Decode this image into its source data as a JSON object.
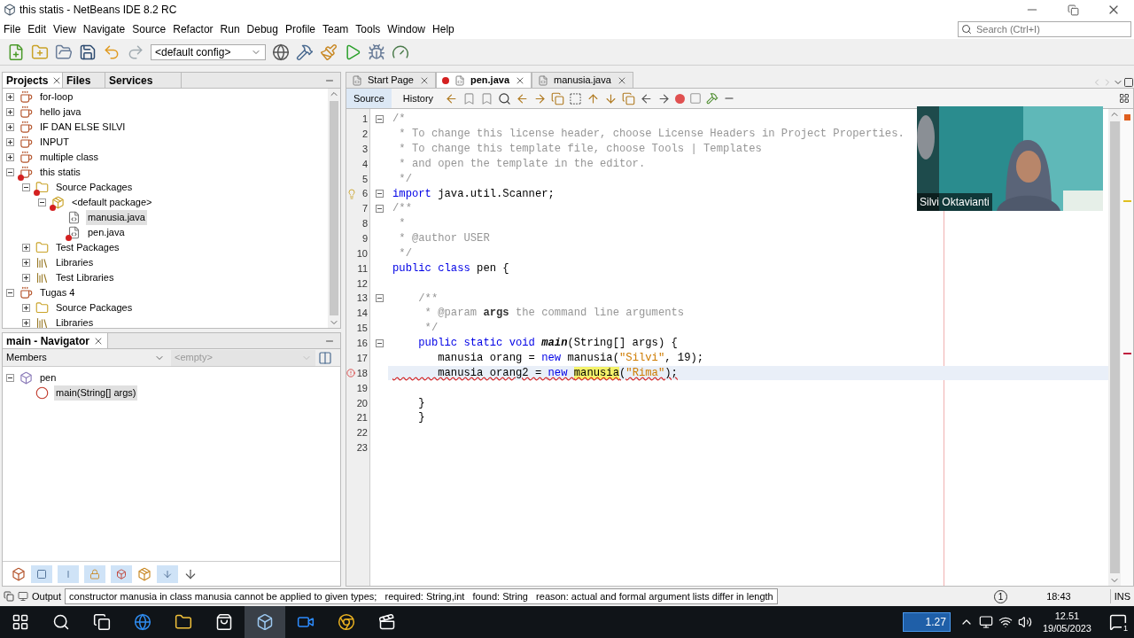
{
  "window": {
    "title": "this statis - NetBeans IDE 8.2 RC",
    "search_placeholder": "Search (Ctrl+I)"
  },
  "menu": [
    "File",
    "Edit",
    "View",
    "Navigate",
    "Source",
    "Refactor",
    "Run",
    "Debug",
    "Profile",
    "Team",
    "Tools",
    "Window",
    "Help"
  ],
  "toolbar": {
    "config": "<default config>"
  },
  "projects_panel": {
    "tabs": [
      {
        "label": "Projects",
        "selected": true,
        "closable": true
      },
      {
        "label": "Files",
        "selected": false,
        "closable": false
      },
      {
        "label": "Services",
        "selected": false,
        "closable": false
      }
    ],
    "tree": [
      {
        "label": "for-loop",
        "kind": "project",
        "expanded": false,
        "selected": false,
        "error": false
      },
      {
        "label": "hello java",
        "kind": "project",
        "expanded": false,
        "selected": false,
        "error": false
      },
      {
        "label": "IF DAN ELSE SILVI",
        "kind": "project",
        "expanded": false,
        "selected": false,
        "error": false
      },
      {
        "label": "INPUT",
        "kind": "project",
        "expanded": false,
        "selected": false,
        "error": false
      },
      {
        "label": "multiple class",
        "kind": "project",
        "expanded": false,
        "selected": false,
        "error": false
      },
      {
        "label": "this statis",
        "kind": "project",
        "expanded": true,
        "selected": false,
        "error": true,
        "children": [
          {
            "label": "Source Packages",
            "kind": "folder",
            "expanded": true,
            "selected": false,
            "error": true,
            "children": [
              {
                "label": "<default package>",
                "kind": "package",
                "expanded": true,
                "selected": false,
                "error": true,
                "children": [
                  {
                    "label": "manusia.java",
                    "kind": "file",
                    "selected": true,
                    "error": false
                  },
                  {
                    "label": "pen.java",
                    "kind": "file",
                    "selected": false,
                    "error": true
                  }
                ]
              }
            ]
          },
          {
            "label": "Test Packages",
            "kind": "folder",
            "expanded": false,
            "selected": false,
            "error": false
          },
          {
            "label": "Libraries",
            "kind": "library",
            "expanded": false,
            "selected": false,
            "error": false
          },
          {
            "label": "Test Libraries",
            "kind": "library",
            "expanded": false,
            "selected": false,
            "error": false
          }
        ]
      },
      {
        "label": "Tugas 4",
        "kind": "project",
        "expanded": true,
        "selected": false,
        "error": false,
        "children": [
          {
            "label": "Source Packages",
            "kind": "folder",
            "expanded": false,
            "selected": false,
            "error": false
          },
          {
            "label": "Libraries",
            "kind": "library",
            "expanded": false,
            "selected": false,
            "error": false
          }
        ]
      }
    ]
  },
  "navigator": {
    "title": "main - Navigator",
    "filter": "Members",
    "member": "<empty>",
    "tree": [
      {
        "label": "pen",
        "kind": "class",
        "expanded": true,
        "selected": false,
        "children": [
          {
            "label": "main(String[] args)",
            "kind": "method",
            "selected": true
          }
        ]
      }
    ]
  },
  "editor": {
    "tabs": [
      {
        "label": "Start Page",
        "selected": false,
        "error": false
      },
      {
        "label": "pen.java",
        "selected": true,
        "error": true
      },
      {
        "label": "manusia.java",
        "selected": false,
        "error": false
      }
    ],
    "views": [
      {
        "label": "Source",
        "selected": true
      },
      {
        "label": "History",
        "selected": false
      }
    ],
    "lines": [
      {
        "number": "1",
        "fold": true,
        "current": false,
        "warning": false,
        "error": false,
        "segments": [
          {
            "text": "/*",
            "kind": "comment"
          }
        ]
      },
      {
        "number": "2",
        "fold": false,
        "current": false,
        "warning": false,
        "error": false,
        "segments": [
          {
            "text": " * To change this license header, choose License Headers in Project Properties.",
            "kind": "comment"
          }
        ]
      },
      {
        "number": "3",
        "fold": false,
        "current": false,
        "warning": false,
        "error": false,
        "segments": [
          {
            "text": " * To change this template file, choose Tools | Templates",
            "kind": "comment"
          }
        ]
      },
      {
        "number": "4",
        "fold": false,
        "current": false,
        "warning": false,
        "error": false,
        "segments": [
          {
            "text": " * and open the template in the editor.",
            "kind": "comment"
          }
        ]
      },
      {
        "number": "5",
        "fold": false,
        "current": false,
        "warning": false,
        "error": false,
        "segments": [
          {
            "text": " */",
            "kind": "comment"
          }
        ]
      },
      {
        "number": "6",
        "fold": true,
        "current": false,
        "warning": true,
        "error": false,
        "segments": [
          {
            "text": "import",
            "kind": "keyword"
          },
          {
            "text": " java.util.Scanner;",
            "kind": "plain"
          }
        ]
      },
      {
        "number": "7",
        "fold": true,
        "current": false,
        "warning": false,
        "error": false,
        "segments": [
          {
            "text": "/**",
            "kind": "comment"
          }
        ]
      },
      {
        "number": "8",
        "fold": false,
        "current": false,
        "warning": false,
        "error": false,
        "segments": [
          {
            "text": " *",
            "kind": "comment"
          }
        ]
      },
      {
        "number": "9",
        "fold": false,
        "current": false,
        "warning": false,
        "error": false,
        "segments": [
          {
            "text": " * @author USER",
            "kind": "comment"
          }
        ]
      },
      {
        "number": "10",
        "fold": false,
        "current": false,
        "warning": false,
        "error": false,
        "segments": [
          {
            "text": " */",
            "kind": "comment"
          }
        ]
      },
      {
        "number": "11",
        "fold": false,
        "current": false,
        "warning": false,
        "error": false,
        "segments": [
          {
            "text": "public class",
            "kind": "keyword"
          },
          {
            "text": " pen {",
            "kind": "plain"
          }
        ]
      },
      {
        "number": "12",
        "fold": false,
        "current": false,
        "warning": false,
        "error": false
      },
      {
        "number": "13",
        "fold": true,
        "current": false,
        "warning": false,
        "error": false,
        "segments": [
          {
            "text": "    /**",
            "kind": "comment"
          }
        ]
      },
      {
        "number": "14",
        "fold": false,
        "current": false,
        "warning": false,
        "error": false,
        "segments": [
          {
            "text": "     * @param ",
            "kind": "comment"
          },
          {
            "text": "args",
            "kind": "tag"
          },
          {
            "text": " the command line arguments",
            "kind": "comment"
          }
        ]
      },
      {
        "number": "15",
        "fold": false,
        "current": false,
        "warning": false,
        "error": false,
        "segments": [
          {
            "text": "     */",
            "kind": "comment"
          }
        ]
      },
      {
        "number": "16",
        "fold": true,
        "current": false,
        "warning": false,
        "error": false,
        "segments": [
          {
            "text": "    public static void",
            "kind": "keyword"
          },
          {
            "text": " main",
            "kind": "method"
          },
          {
            "text": "(String[] args) {",
            "kind": "plain"
          }
        ]
      },
      {
        "number": "17",
        "fold": false,
        "current": false,
        "warning": false,
        "error": false,
        "segments": [
          {
            "text": "       manusia orang = ",
            "kind": "plain"
          },
          {
            "text": "new",
            "kind": "keyword"
          },
          {
            "text": " manusia(",
            "kind": "plain"
          },
          {
            "text": "\"Silvi\"",
            "kind": "string"
          },
          {
            "text": ", 19);",
            "kind": "plain"
          }
        ]
      },
      {
        "number": "18",
        "fold": false,
        "current": true,
        "warning": false,
        "error": true,
        "segments": [
          {
            "text": "       manusia orang2 = ",
            "kind": "plain"
          },
          {
            "text": "new ",
            "kind": "keyword"
          },
          {
            "text": "manusia",
            "kind": "match"
          },
          {
            "text": "(",
            "kind": "plain"
          },
          {
            "text": "\"Rima\"",
            "kind": "string"
          },
          {
            "text": ");",
            "kind": "plain"
          }
        ]
      },
      {
        "number": "19",
        "fold": false,
        "current": false,
        "warning": false,
        "error": false
      },
      {
        "number": "20",
        "fold": false,
        "current": false,
        "warning": false,
        "error": false,
        "segments": [
          {
            "text": "    }",
            "kind": "plain"
          }
        ]
      },
      {
        "number": "21",
        "fold": false,
        "current": false,
        "warning": false,
        "error": false,
        "segments": [
          {
            "text": "    }",
            "kind": "plain"
          }
        ]
      },
      {
        "number": "22",
        "fold": false,
        "current": false,
        "warning": false,
        "error": false
      },
      {
        "number": "23",
        "fold": false,
        "current": false,
        "warning": false,
        "error": false
      }
    ]
  },
  "video": {
    "kind": "picture",
    "name": "Silvi Oktavianti"
  },
  "status_bar": {
    "output": "Output",
    "message": "constructor manusia in class manusia cannot be applied to given types;   required: String,int   found: String   reason: actual and formal argument lists differ in length",
    "notifications": "1",
    "position": "18:43",
    "mode": "INS"
  },
  "taskbar": {
    "battery": "1.27",
    "time": "12.51",
    "date": "19/05/2023",
    "notifications": "1"
  }
}
